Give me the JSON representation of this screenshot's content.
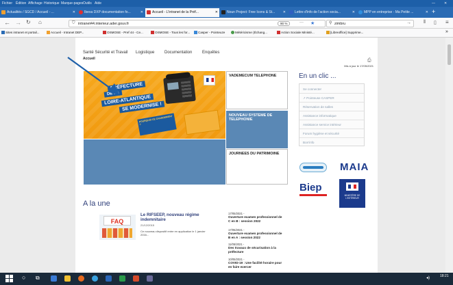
{
  "menu": [
    "Fichier",
    "Édition",
    "Affichage",
    "Historique",
    "Marque-pages",
    "Outils",
    "Aide"
  ],
  "tabs": [
    {
      "label": "Actualités / SGCD / Accueil - ...",
      "color": "#f0a030"
    },
    {
      "label": "Ibexa DXP documentation fo...",
      "color": "#e03030"
    },
    {
      "label": "Accueil - L'intranet de la Préf...",
      "color": "#d03030"
    },
    {
      "label": "Noun Project: Free Icons & St...",
      "color": "#222222"
    },
    {
      "label": "Lettre d'info de l'action socia...",
      "color": "#3060c0"
    },
    {
      "label": "MPP en entreprise - Ma Petite ...",
      "color": "#3090e0"
    }
  ],
  "nav": {
    "url": "intranet44.interieur.ader.gouv.fr",
    "zoom": "90 %",
    "search": "zimbru"
  },
  "bookmarks": [
    "Sites intranet et portail...",
    "Accueil - Intranet DEP...",
    "OSMOSE - Pref 44 - Ce...",
    "OSMOSE - Tous les for...",
    "Casper - Pointeuze",
    "Météricisme (Échang...",
    "Action Sociale Ministé...",
    "[Libreoffice] Supprime..."
  ],
  "page": {
    "topnav": [
      "Santé Sécurité et Travail",
      "Logistique",
      "Documentation",
      "Enquêtes"
    ],
    "breadcrumb": "Accueil",
    "updated": "Mis à jour le 17/05/2021",
    "banner": {
      "lines": [
        "PRÉFECTURE",
        "DE LA",
        "LOIRE-ATLANTIQUE",
        "SE MODERNISE !"
      ],
      "callout": "POURQUOI CE CHANGEMENT ?"
    },
    "headers": [
      "VADEMECUM TELEPHONE",
      "NOUVEAU SYSTEME DE TELEPHONIE",
      "JOURNEES DU PATRIMOINE"
    ],
    "en_un_clic": "En un clic ...",
    "links": [
      "Se connecter",
      "Pointeuse CASPER",
      "Réservation de salles",
      "Assistance informatique",
      "Assistance service intérieur",
      "Forum hygiène et sécurité",
      "Bon'info"
    ],
    "logos": {
      "maia": "MAIA",
      "biep": "Biep",
      "ministere": "MINISTÈRE DE L'INTÉRIEUR"
    },
    "a_la_une": "A la une",
    "feature": {
      "title": "Le RIFSEEP, nouveau régime indemnitaire",
      "date": "21/12/2015",
      "text": "Ce nouveau dispositif entre en application le 1 janvier 2016...",
      "badge": "FAQ"
    },
    "news": [
      {
        "date": "17/05/2021 -",
        "title": "Ouverture examen professionnel de C en B : session 2022"
      },
      {
        "date": "17/05/2021 -",
        "title": "Ouverture examen professionnel de B en A : session 2022"
      },
      {
        "date": "11/05/2021 -",
        "title": "Des travaux de sécurisation à la préfecture"
      },
      {
        "date": "10/05/2021 -",
        "title": "COVID-19 : Une facilité horaire pour en faire exercer"
      }
    ]
  },
  "taskbar": {
    "time": "18:21"
  }
}
